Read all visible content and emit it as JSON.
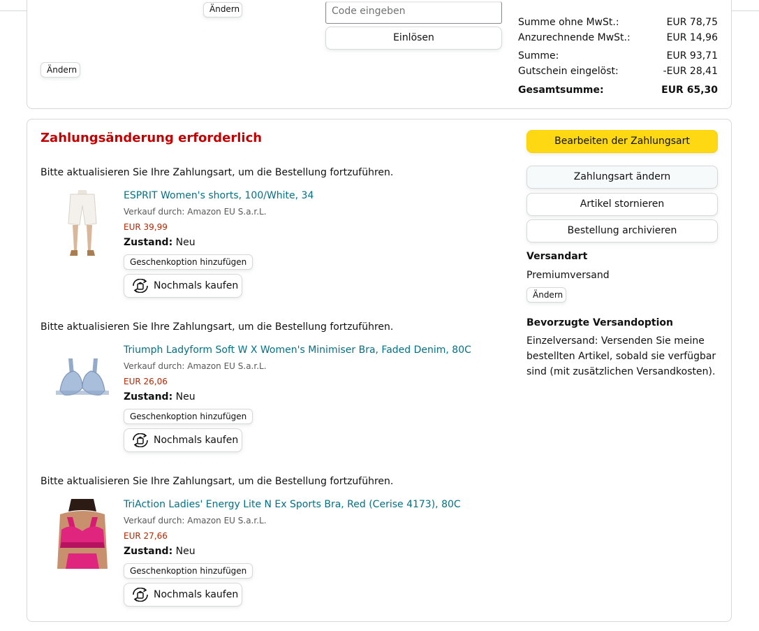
{
  "summary": {
    "prior_change_label": "Ändern",
    "change_label": "Ändern",
    "code_placeholder": "Code eingeben",
    "redeem_label": "Einlösen",
    "rows": [
      {
        "label": "Summe ohne MwSt.:",
        "value": "EUR 78,75"
      },
      {
        "label": "Anzurechnende MwSt.:",
        "value": "EUR 14,96"
      },
      {
        "label": "Summe:",
        "value": "EUR 93,71"
      },
      {
        "label": "Gutschein eingelöst:",
        "value": "-EUR 28,41"
      }
    ],
    "total": {
      "label": "Gesamtsumme:",
      "value": "EUR 65,30"
    }
  },
  "payment": {
    "heading": "Zahlungsänderung erforderlich",
    "notice": "Bitte aktualisieren Sie Ihre Zahlungsart, um die Bestellung fortzuführen.",
    "items": [
      {
        "title": "ESPRIT Women's shorts, 100/White, 34",
        "seller": "Verkauf durch: Amazon EU S.a.r.L.",
        "price": "EUR 39,99",
        "condition_label": "Zustand:",
        "condition_value": "Neu",
        "gift_label": "Geschenkoption hinzufügen",
        "buy_again_label": "Nochmals kaufen"
      },
      {
        "title": "Triumph Ladyform Soft W X Women's Minimiser Bra, Faded Denim, 80C",
        "seller": "Verkauf durch: Amazon EU S.a.r.L.",
        "price": "EUR 26,06",
        "condition_label": "Zustand:",
        "condition_value": "Neu",
        "gift_label": "Geschenkoption hinzufügen",
        "buy_again_label": "Nochmals kaufen"
      },
      {
        "title": "TriAction Ladies' Energy Lite N Ex Sports Bra, Red (Cerise 4173), 80C",
        "seller": "Verkauf durch: Amazon EU S.a.r.L.",
        "price": "EUR 27,66",
        "condition_label": "Zustand:",
        "condition_value": "Neu",
        "gift_label": "Geschenkoption hinzufügen",
        "buy_again_label": "Nochmals kaufen"
      }
    ]
  },
  "sidebar": {
    "edit_payment": "Bearbeiten der Zahlungsart",
    "change_payment": "Zahlungsart ändern",
    "cancel_items": "Artikel stornieren",
    "archive_order": "Bestellung archivieren",
    "shipping_method_heading": "Versandart",
    "shipping_method_value": "Premiumversand",
    "shipping_change": "Ändern",
    "preferred_heading": "Bevorzugte Versandoption",
    "preferred_text_1": "Einzelversand: Versenden Sie meine",
    "preferred_text_2": "bestellten Artikel, sobald sie verfügbar",
    "preferred_text_3": "sind (mit zusätzlichen Versandkosten)."
  },
  "colors": {
    "alert_red": "#c40000",
    "link_teal": "#007185",
    "price_red": "#b12704",
    "primary_yellow": "#ffd814"
  }
}
